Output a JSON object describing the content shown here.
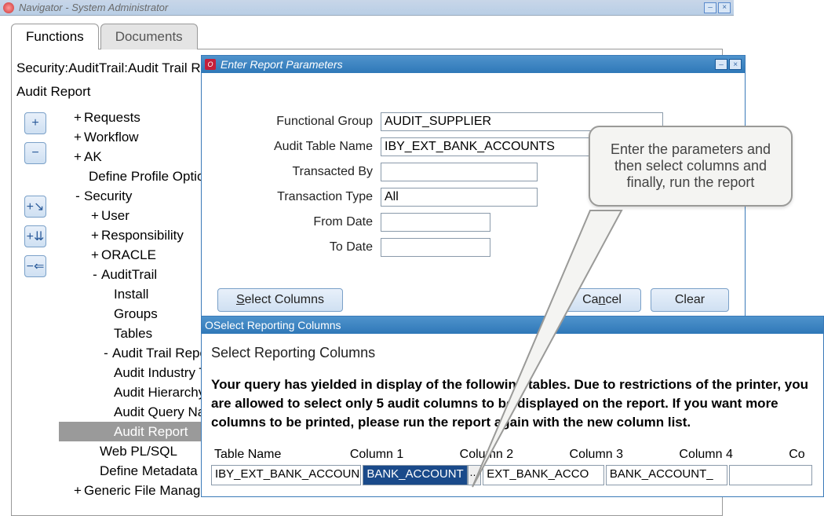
{
  "navigator": {
    "title": "Navigator - System Administrator",
    "tabs": {
      "functions": "Functions",
      "documents": "Documents"
    },
    "breadcrumb": "Security:AuditTrail:Audit Trail Reporting",
    "page_title": "Audit Report",
    "tree": {
      "requests": "Requests",
      "workflow": "Workflow",
      "ak": "AK",
      "define_profile": "Define Profile Options",
      "security": "Security",
      "user": "User",
      "responsibility": "Responsibility",
      "oracle": "ORACLE",
      "audit_trail": "AuditTrail",
      "install": "Install",
      "groups": "Groups",
      "tables": "Tables",
      "atr": "Audit Trail Reporting",
      "audit_industry": "Audit Industry T",
      "audit_hierarchy": "Audit Hierarchy",
      "audit_query": "Audit Query Na",
      "audit_report": "Audit Report",
      "web_plsql": "Web PL/SQL",
      "define_metadata": "Define Metadata",
      "generic_file": "Generic File Manager"
    },
    "buttons": {
      "plus": "+",
      "minus": "−",
      "to_right": "⇘",
      "multi": "⇊",
      "left": "⇐"
    }
  },
  "params": {
    "title": "Enter Report Parameters",
    "labels": {
      "functional_group": "Functional Group",
      "audit_table_name": "Audit Table Name",
      "transacted_by": "Transacted By",
      "transaction_type": "Transaction Type",
      "from_date": "From Date",
      "to_date": "To Date"
    },
    "values": {
      "functional_group": "AUDIT_SUPPLIER",
      "audit_table_name": "IBY_EXT_BANK_ACCOUNTS",
      "transacted_by": "",
      "transaction_type": "All",
      "from_date": "",
      "to_date": ""
    },
    "buttons": {
      "select_columns": "Select Columns",
      "cancel": "Cancel",
      "clear": "Clear"
    }
  },
  "cols": {
    "title": "Select Reporting Columns",
    "heading": "Select Reporting Columns",
    "message": "Your query has yielded in display of the following tables.  Due to restrictions of the printer, you are allowed to select only 5 audit columns to be displayed on the report.  If you want more columns to be printed, please run the report again with the new column list.",
    "headers": {
      "table_name": "Table Name",
      "c1": "Column 1",
      "c2": "Column 2",
      "c3": "Column 3",
      "c4": "Column 4",
      "c5": "Co"
    },
    "row": {
      "table_name": "IBY_EXT_BANK_ACCOUN",
      "c1": "BANK_ACCOUNT",
      "c2": "EXT_BANK_ACCO",
      "c3": "BANK_ACCOUNT_",
      "c4": ""
    }
  },
  "callout": "Enter the parameters and then select columns and finally, run the report"
}
